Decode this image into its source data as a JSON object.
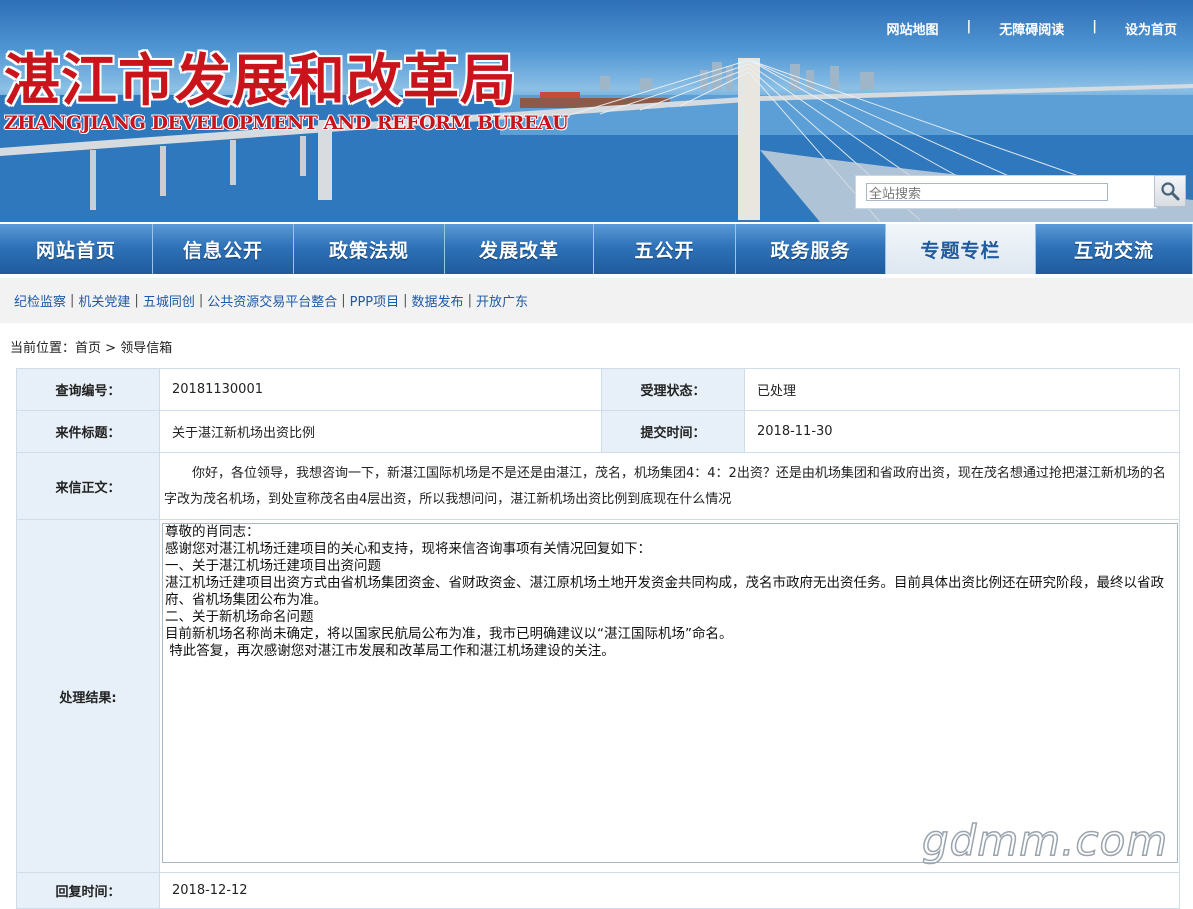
{
  "header": {
    "logo_cn": "湛江市发展和改革局",
    "logo_en": "ZHANGJIANG DEVELOPMENT AND REFORM BUREAU",
    "top_links": [
      "网站地图",
      "无障碍阅读",
      "设为首页"
    ],
    "top_sep": "|",
    "search": {
      "value": "全站搜索"
    }
  },
  "nav": {
    "items": [
      "网站首页",
      "信息公开",
      "政策法规",
      "发展改革",
      "五公开",
      "政务服务",
      "专题专栏",
      "互动交流"
    ],
    "active": "专题专栏"
  },
  "sublinks": [
    "纪检监察",
    "机关党建",
    "五城同创",
    "公共资源交易平台整合",
    "PPP项目",
    "数据发布",
    "开放广东"
  ],
  "sublink_sep": "|",
  "breadcrumb": {
    "prefix": "当前位置：",
    "home": "首页",
    "sep": " > ",
    "current": "领导信箱"
  },
  "detail": {
    "query_no_label": "查询编号：",
    "query_no": "20181130001",
    "status_label": "受理状态：",
    "status": "已处理",
    "title_label": "来件标题：",
    "title": "关于湛江新机场出资比例",
    "submit_label": "提交时间：",
    "submit_time": "2018-11-30",
    "body_label": "来信正文：",
    "body": "你好，各位领导，我想咨询一下，新湛江国际机场是不是还是由湛江，茂名，机场集团4：4：2出资？还是由机场集团和省政府出资，现在茂名想通过抢把湛江新机场的名字改为茂名机场，到处宣称茂名由4层出资，所以我想问问，湛江新机场出资比例到底现在什么情况",
    "result_label": "处理结果:",
    "result": "尊敬的肖同志：\n感谢您对湛江机场迁建项目的关心和支持，现将来信咨询事项有关情况回复如下：\n一、关于湛江机场迁建项目出资问题\n湛江机场迁建项目出资方式由省机场集团资金、省财政资金、湛江原机场土地开发资金共同构成，茂名市政府无出资任务。目前具体出资比例还在研究阶段，最终以省政府、省机场集团公布为准。\n二、关于新机场命名问题\n目前新机场名称尚未确定，将以国家民航局公布为准，我市已明确建议以“湛江国际机场”命名。\n 特此答复，再次感谢您对湛江市发展和改革局工作和湛江机场建设的关注。",
    "reply_time_label": "回复时间：",
    "reply_time": "2018-12-12"
  },
  "watermark": "gdmm.com",
  "colors": {
    "brand_red": "#c8141a",
    "nav_blue": "#2565a8",
    "link_blue": "#1f5aa6",
    "label_bg": "#e7f0f8"
  }
}
